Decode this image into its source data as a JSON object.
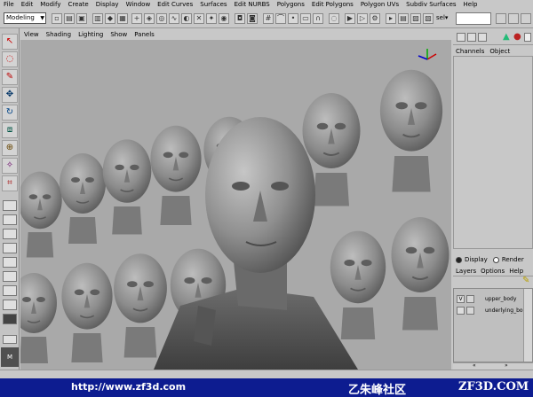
{
  "menubar": {
    "items": [
      "File",
      "Edit",
      "Modify",
      "Create",
      "Display",
      "Window",
      "Edit Curves",
      "Surfaces",
      "Edit NURBS",
      "Polygons",
      "Edit Polygons",
      "Polygon UVs",
      "Subdiv Surfaces",
      "Help"
    ]
  },
  "statusline": {
    "mode": "Modeling",
    "sel_label": "sel▾"
  },
  "viewport": {
    "menu": [
      "View",
      "Shading",
      "Lighting",
      "Show",
      "Panels"
    ],
    "background": "#a9a9a9"
  },
  "channelbox": {
    "tabs": [
      "Channels",
      "Object"
    ]
  },
  "layers": {
    "radio": [
      {
        "label": "Display",
        "selected": true
      },
      {
        "label": "Render",
        "selected": false
      }
    ],
    "menu": [
      "Layers",
      "Options",
      "Help"
    ],
    "items": [
      {
        "visible": "V",
        "name": "upper_body"
      },
      {
        "visible": "",
        "name": "underlying_bo"
      }
    ]
  },
  "banner": {
    "url": "http://www.zf3d.com",
    "logo": "乙朱峰社区",
    "site": "ZF3D.COM",
    "color": "#0d1c90"
  },
  "icons": [
    "select-tool-icon",
    "lasso-tool-icon",
    "paint-tool-icon",
    "move-tool-icon",
    "rotate-tool-icon",
    "scale-tool-icon",
    "manipulator-icon",
    "soft-mod-icon",
    "lattice-icon",
    "view-cube-icon"
  ]
}
